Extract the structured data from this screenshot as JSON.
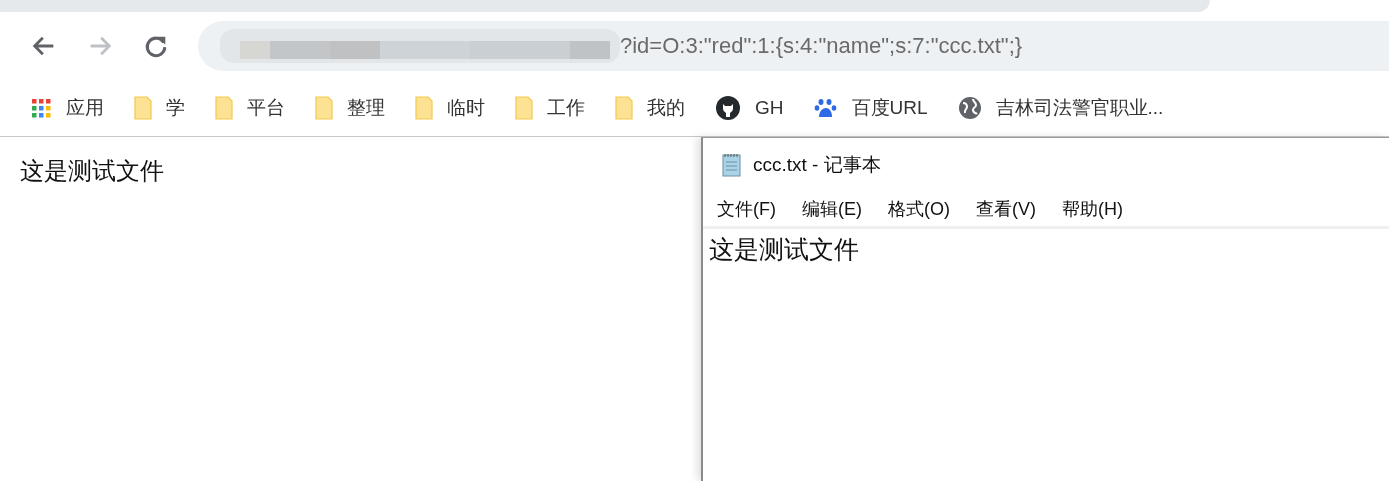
{
  "browser": {
    "address_bar": {
      "url_visible": "?id=O:3:\"red\":1:{s:4:\"name\";s:7:\"ccc.txt\";}"
    },
    "bookmarks": [
      {
        "kind": "apps",
        "label": "应用"
      },
      {
        "kind": "folder",
        "label": "学"
      },
      {
        "kind": "folder",
        "label": "平台"
      },
      {
        "kind": "folder",
        "label": "整理"
      },
      {
        "kind": "folder",
        "label": "临时"
      },
      {
        "kind": "folder",
        "label": "工作"
      },
      {
        "kind": "folder",
        "label": "我的"
      },
      {
        "kind": "github",
        "label": "GH"
      },
      {
        "kind": "paw",
        "label": "百度URL"
      },
      {
        "kind": "globe",
        "label": "吉林司法警官职业..."
      }
    ]
  },
  "page": {
    "text": "这是测试文件"
  },
  "notepad": {
    "title": "ccc.txt - 记事本",
    "menu": [
      "文件(F)",
      "编辑(E)",
      "格式(O)",
      "查看(V)",
      "帮助(H)"
    ],
    "content": "这是测试文件"
  }
}
